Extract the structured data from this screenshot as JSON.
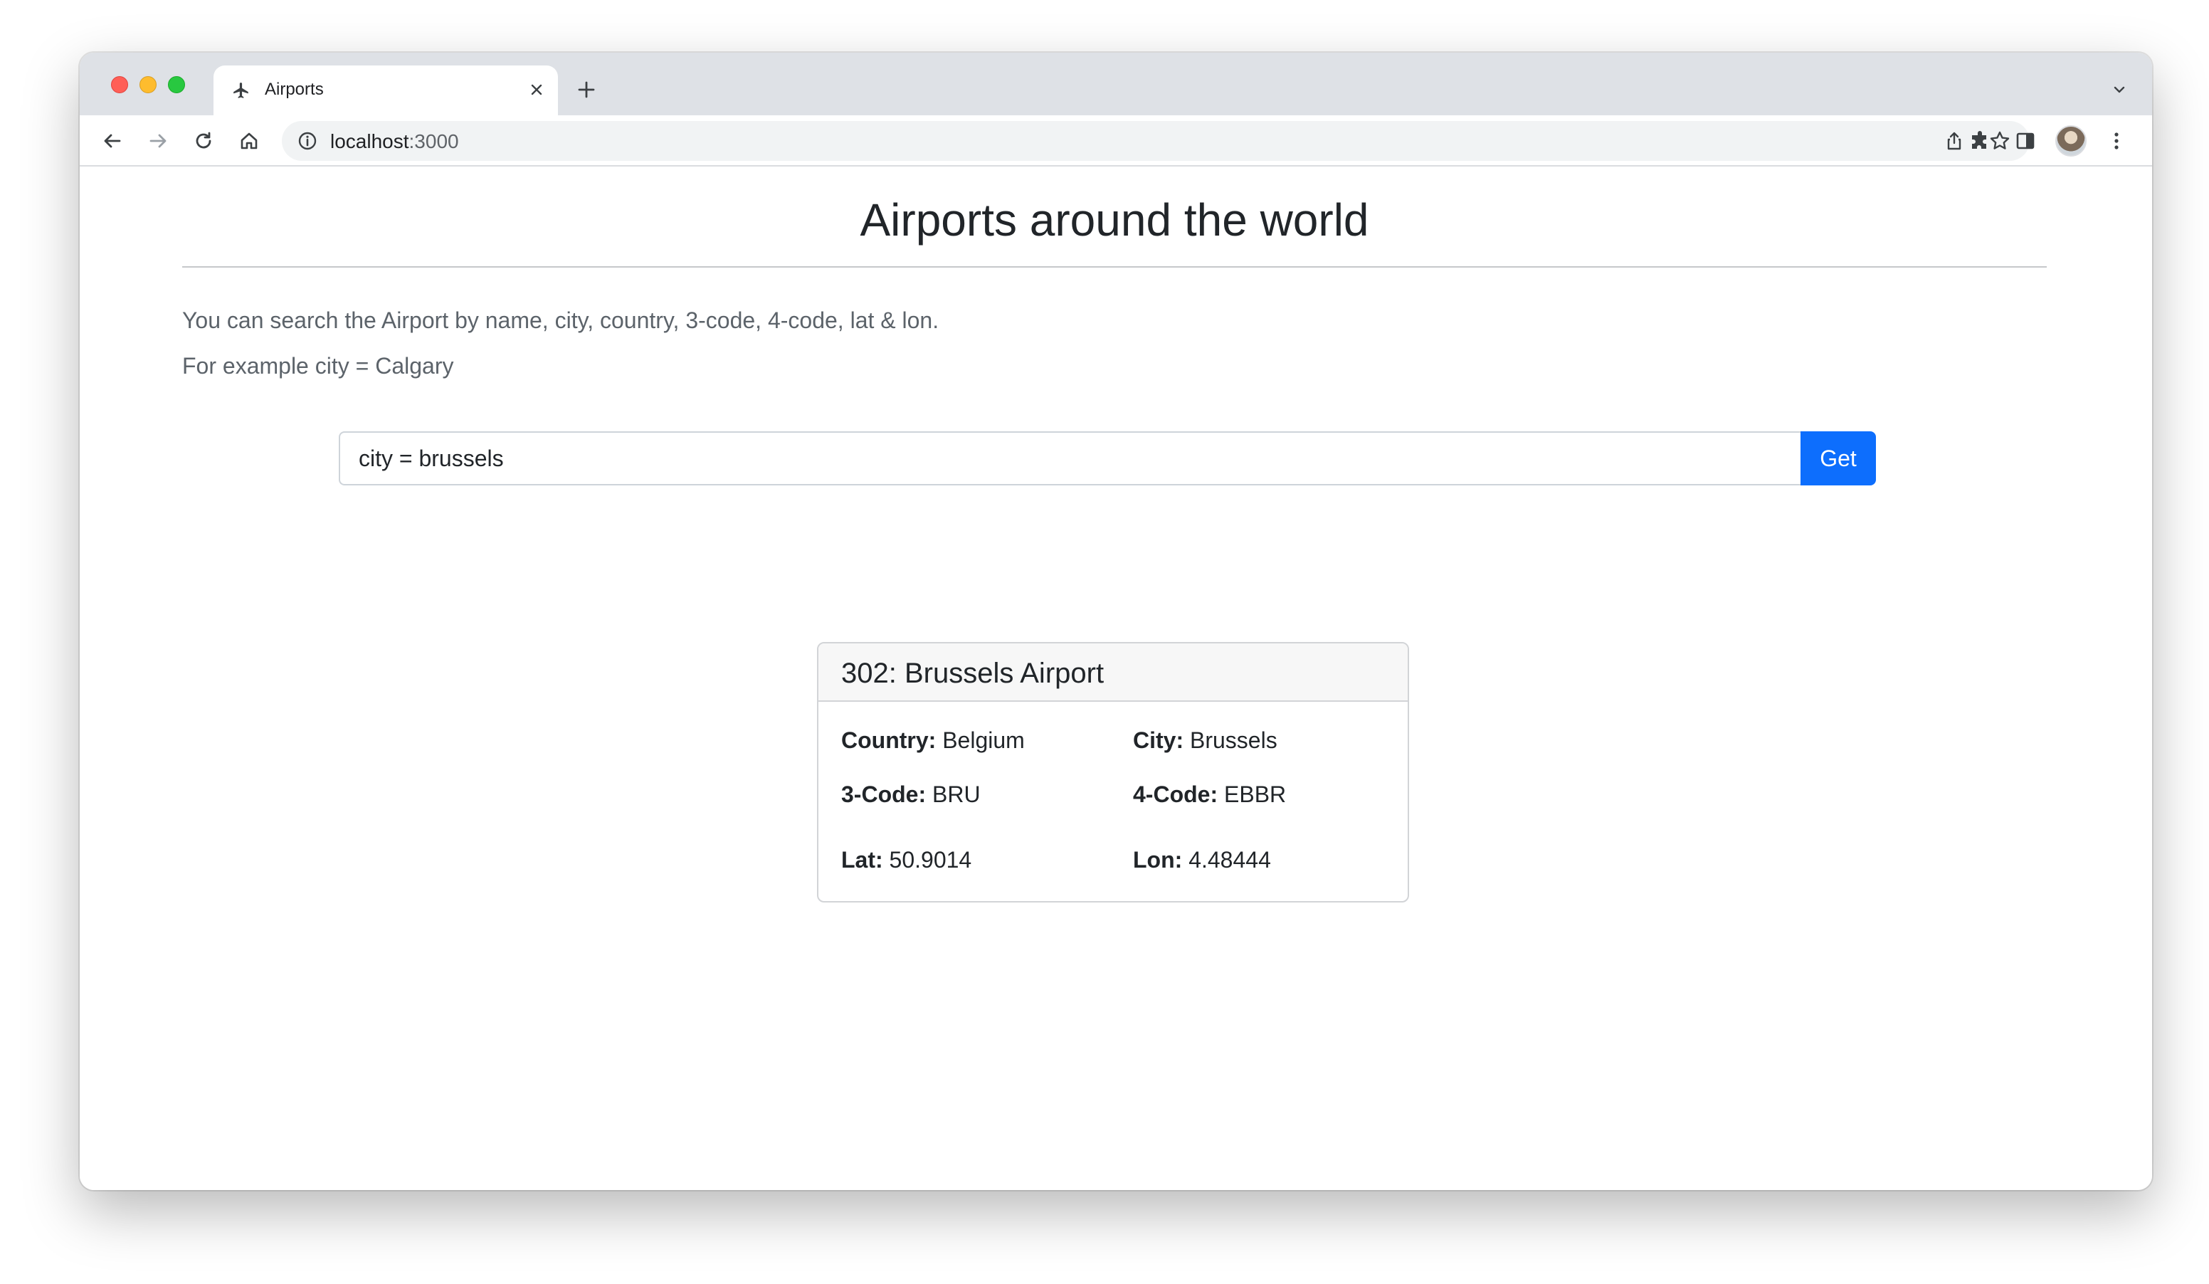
{
  "browser": {
    "tab_title": "Airports",
    "url_host": "localhost",
    "url_port": ":3000"
  },
  "page": {
    "title": "Airports around the world",
    "description": "You can search the Airport by name, city, country, 3-code, 4-code, lat & lon.",
    "example": "For example city = Calgary"
  },
  "search": {
    "value": "city = brussels",
    "button_label": "Get"
  },
  "result": {
    "heading": "302: Brussels Airport",
    "fields": [
      {
        "label": "Country:",
        "value": "Belgium"
      },
      {
        "label": "City:",
        "value": "Brussels"
      },
      {
        "label": "3-Code:",
        "value": "BRU"
      },
      {
        "label": "4-Code:",
        "value": "EBBR"
      },
      {
        "label": "Lat:",
        "value": "50.9014"
      },
      {
        "label": "Lon:",
        "value": "4.48444"
      }
    ]
  },
  "colors": {
    "accent": "#0d6efd",
    "tabstrip": "#dee1e6"
  },
  "icons": [
    "airplane-icon",
    "close-icon",
    "plus-icon",
    "chevron-down-icon",
    "back-icon",
    "forward-icon",
    "reload-icon",
    "home-icon",
    "info-icon",
    "share-icon",
    "star-icon",
    "extensions-icon",
    "side-panel-icon",
    "menu-icon"
  ]
}
